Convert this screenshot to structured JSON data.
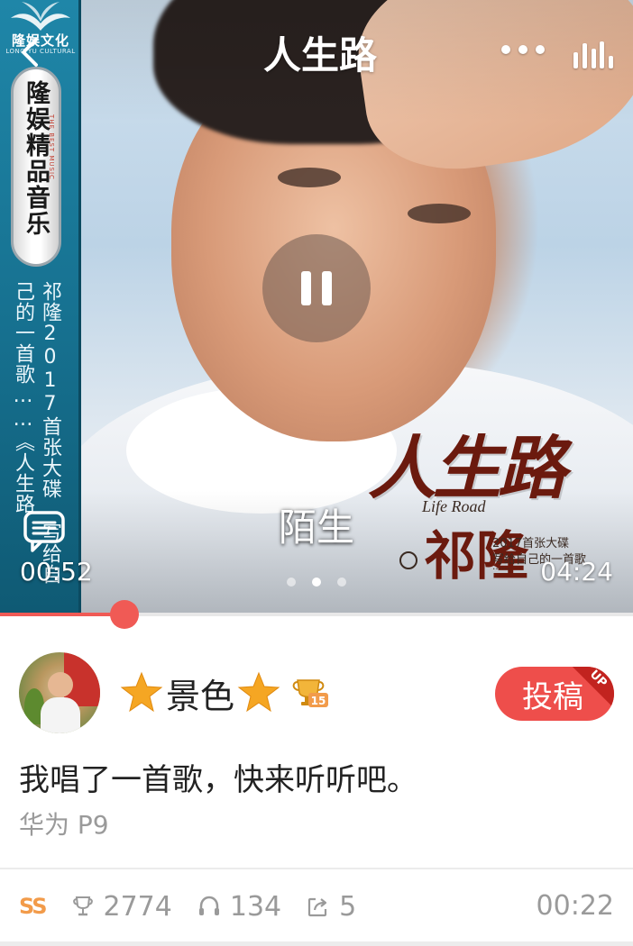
{
  "header": {
    "title": "人生路",
    "back_icon": "chevron-left-icon",
    "more_icon": "more-dots-icon",
    "equalizer_icon": "equalizer-icon"
  },
  "album_art": {
    "banner_logo": "隆娱文化",
    "banner_logo_sub": "LONG YU CULTURAL",
    "plaque_text": "隆娱精品音乐",
    "plaque_sub": "THE BEST MUSIC",
    "banner_vertical": "祁隆2017首张大碟 写给自己的一首歌……《人生路",
    "title_calligraphy": "人生路",
    "title_en": "Life Road",
    "artist_calligraphy": "祁隆",
    "line1": "2017首张大碟",
    "line2": "写给自己的一首歌",
    "line3": "……"
  },
  "player": {
    "state": "playing",
    "lyric": "陌生",
    "current_time": "00:52",
    "total_time": "04:24",
    "progress": 0.196,
    "pager_count": 3,
    "pager_active": 1
  },
  "user": {
    "name": "景色",
    "trophy_level": "15",
    "submit_label": "投稿",
    "submit_badge": "UP",
    "description": "我唱了一首歌，快来听听吧。",
    "device": "华为 P9"
  },
  "stats": {
    "tag": "SS",
    "likes": "2774",
    "listens": "134",
    "shares": "5",
    "duration": "00:22"
  },
  "colors": {
    "accent": "#ee4e4b",
    "tag": "#f29b4a",
    "muted": "#9a9a9a",
    "star": "#f5a623"
  }
}
